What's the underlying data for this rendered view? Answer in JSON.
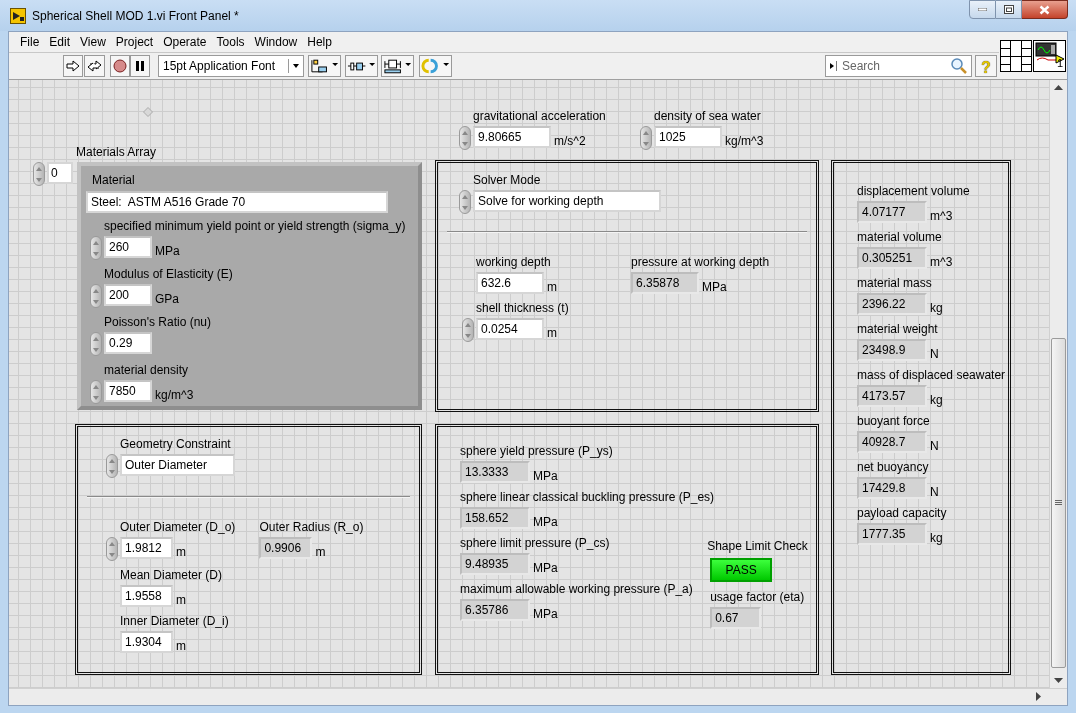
{
  "window": {
    "title": "Spherical Shell MOD 1.vi Front Panel *"
  },
  "menu": [
    "File",
    "Edit",
    "View",
    "Project",
    "Operate",
    "Tools",
    "Window",
    "Help"
  ],
  "toolbar": {
    "font": "15pt Application Font",
    "search_placeholder": "Search",
    "help": "?",
    "vi_icon_number": "1"
  },
  "panel": {
    "gravity": {
      "label": "gravitational acceleration",
      "value": "9.80665",
      "unit": "m/s^2",
      "kind": "spin_control"
    },
    "seawater_density": {
      "label": "density of sea water",
      "value": "1025",
      "unit": "kg/m^3",
      "kind": "spin_control"
    },
    "materials_array": {
      "label": "Materials Array",
      "index": "0",
      "material": {
        "label": "Material",
        "name": {
          "value": "Steel:  ASTM A516 Grade 70",
          "kind": "control"
        },
        "fields": [
          {
            "label": "specified minimum yield point or yield strength (sigma_y)",
            "value": "260",
            "unit": "MPa",
            "kind": "spin_control"
          },
          {
            "label": "Modulus of Elasticity (E)",
            "value": "200",
            "unit": "GPa",
            "kind": "spin_control"
          },
          {
            "label": "Poisson's Ratio (nu)",
            "value": "0.29",
            "kind": "spin_control"
          },
          {
            "label": "material density",
            "value": "7850",
            "unit": "kg/m^3",
            "kind": "spin_control"
          }
        ]
      }
    },
    "solver": {
      "mode": {
        "label": "Solver Mode",
        "value": "Solve for working depth",
        "kind": "spin_control"
      },
      "working_depth": {
        "label": "working depth",
        "value": "632.6",
        "unit": "m",
        "kind": "control"
      },
      "pressure_at_depth": {
        "label": "pressure at working depth",
        "value": "6.35878",
        "unit": "MPa",
        "kind": "indicator"
      },
      "shell_thickness": {
        "label": "shell thickness (t)",
        "value": "0.0254",
        "unit": "m",
        "kind": "spin_control"
      }
    },
    "geometry": {
      "constraint": {
        "label": "Geometry Constraint",
        "value": "Outer Diameter",
        "kind": "spin_control"
      },
      "outer_diameter": {
        "label": "Outer Diameter (D_o)",
        "value": "1.9812",
        "unit": "m",
        "kind": "spin_control"
      },
      "outer_radius": {
        "label": "Outer Radius (R_o)",
        "value": "0.9906",
        "unit": "m",
        "kind": "indicator"
      },
      "mean_diameter": {
        "label": "Mean Diameter (D)",
        "value": "1.9558",
        "unit": "m",
        "kind": "control"
      },
      "inner_diameter": {
        "label": "Inner Diameter (D_i)",
        "value": "1.9304",
        "unit": "m",
        "kind": "control"
      }
    },
    "pressures": {
      "fields": [
        {
          "label": "sphere yield pressure (P_ys)",
          "value": "13.3333",
          "unit": "MPa",
          "kind": "indicator"
        },
        {
          "label": "sphere linear classical buckling pressure (P_es)",
          "value": "158.652",
          "unit": "MPa",
          "kind": "indicator"
        },
        {
          "label": "sphere limit pressure (P_cs)",
          "value": "9.48935",
          "unit": "MPa",
          "kind": "indicator"
        },
        {
          "label": "maximum allowable working pressure (P_a)",
          "value": "6.35786",
          "unit": "MPa",
          "kind": "indicator"
        }
      ],
      "shape_limit_check": {
        "label": "Shape Limit Check",
        "text": "PASS",
        "on": true
      },
      "usage_factor": {
        "label": "usage factor (eta)",
        "value": "0.67",
        "kind": "indicator"
      }
    },
    "results": [
      {
        "label": "displacement volume",
        "value": "4.07177",
        "unit": "m^3",
        "kind": "indicator"
      },
      {
        "label": "material volume",
        "value": "0.305251",
        "unit": "m^3",
        "kind": "indicator"
      },
      {
        "label": "material mass",
        "value": "2396.22",
        "unit": "kg",
        "kind": "indicator"
      },
      {
        "label": "material weight",
        "value": "23498.9",
        "unit": "N",
        "kind": "indicator"
      },
      {
        "label": "mass of displaced seawater",
        "value": "4173.57",
        "unit": "kg",
        "kind": "indicator"
      },
      {
        "label": "buoyant force",
        "value": "40928.7",
        "unit": "N",
        "kind": "indicator"
      },
      {
        "label": "net buoyancy",
        "value": "17429.8",
        "unit": "N",
        "kind": "indicator"
      },
      {
        "label": "payload capacity",
        "value": "1777.35",
        "unit": "kg",
        "kind": "indicator"
      }
    ]
  }
}
